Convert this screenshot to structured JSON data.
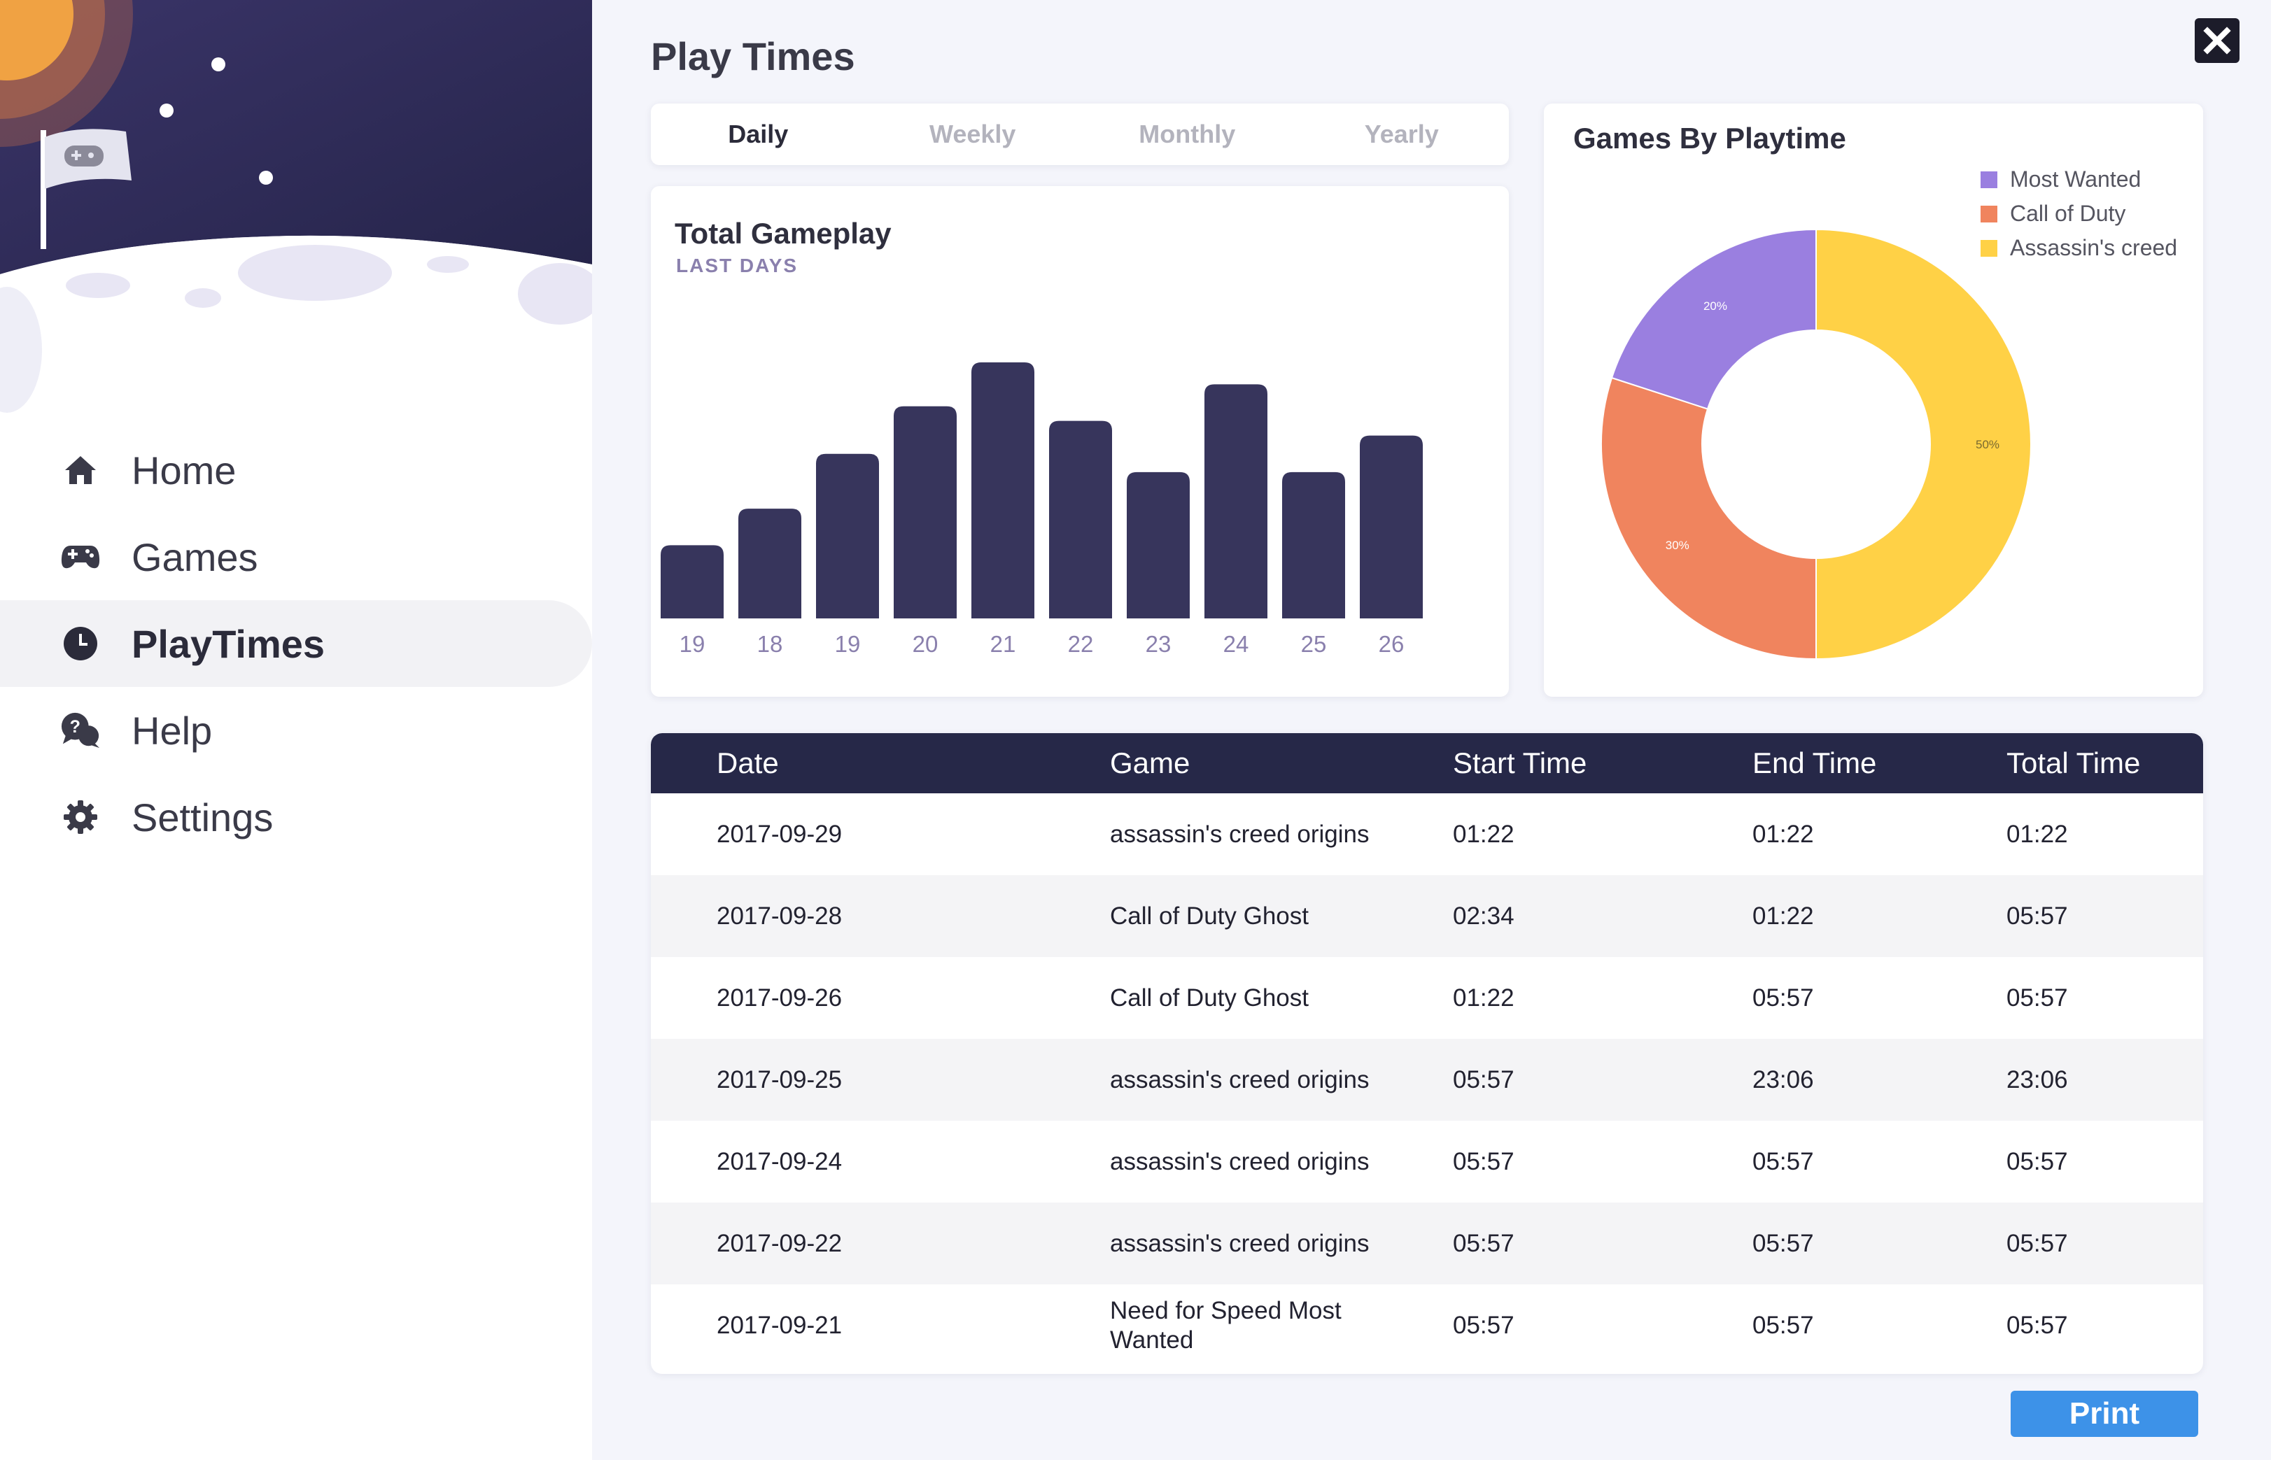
{
  "sidebar": {
    "items": [
      {
        "label": "Home",
        "icon": "home-icon",
        "active": false
      },
      {
        "label": "Games",
        "icon": "gamepad-icon",
        "active": false
      },
      {
        "label": "PlayTimes",
        "icon": "clock-icon",
        "active": true
      },
      {
        "label": "Help",
        "icon": "help-chat-icon",
        "active": false
      },
      {
        "label": "Settings",
        "icon": "gear-icon",
        "active": false
      }
    ]
  },
  "page": {
    "title": "Play Times"
  },
  "tabs": [
    {
      "label": "Daily",
      "active": true
    },
    {
      "label": "Weekly",
      "active": false
    },
    {
      "label": "Monthly",
      "active": false
    },
    {
      "label": "Yearly",
      "active": false
    }
  ],
  "gameplay": {
    "title": "Total Gameplay",
    "subtitle": "LAST DAYS"
  },
  "donut": {
    "title": "Games By Playtime"
  },
  "chart_data": [
    {
      "type": "bar",
      "categories": [
        "19",
        "18",
        "19",
        "20",
        "21",
        "22",
        "23",
        "24",
        "25",
        "26"
      ],
      "values": [
        20,
        30,
        45,
        58,
        70,
        54,
        40,
        64,
        40,
        50
      ],
      "title": "Total Gameplay",
      "subtitle": "LAST DAYS",
      "ylim": [
        0,
        70
      ],
      "color": "#37355c"
    },
    {
      "type": "pie",
      "title": "Games By Playtime",
      "labels": [
        "Most Wanted",
        "Call of Duty",
        "Assassin's creed"
      ],
      "values": [
        20,
        30,
        50
      ],
      "value_labels": [
        "20%",
        "30%",
        "50%"
      ],
      "colors": [
        "#9a7fe0",
        "#f0845e",
        "#ffd146"
      ],
      "legend": "top-right",
      "donut": true
    }
  ],
  "table": {
    "headers": [
      "Date",
      "Game",
      "Start Time",
      "End Time",
      "Total Time"
    ],
    "rows": [
      [
        "2017-09-29",
        "assassin's creed origins",
        "01:22",
        "01:22",
        "01:22"
      ],
      [
        "2017-09-28",
        "Call of Duty Ghost",
        "02:34",
        "01:22",
        "05:57"
      ],
      [
        "2017-09-26",
        "Call of Duty Ghost",
        "01:22",
        "05:57",
        "05:57"
      ],
      [
        "2017-09-25",
        "assassin's creed origins",
        "05:57",
        "23:06",
        "23:06"
      ],
      [
        "2017-09-24",
        "assassin's creed origins",
        "05:57",
        "05:57",
        "05:57"
      ],
      [
        "2017-09-22",
        "assassin's creed origins",
        "05:57",
        "05:57",
        "05:57"
      ],
      [
        "2017-09-21",
        "Need for Speed Most Wanted",
        "05:57",
        "05:57",
        "05:57"
      ]
    ]
  },
  "actions": {
    "print_label": "Print",
    "close_icon": "close-icon"
  },
  "colors": {
    "sidebar_sky": "#2d2a55",
    "accent": "#3d92e8",
    "table_header": "#262848",
    "bar": "#37355c"
  }
}
